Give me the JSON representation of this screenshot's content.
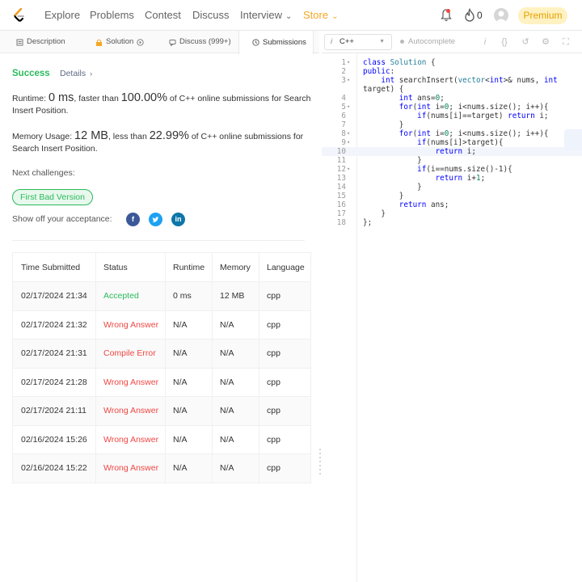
{
  "nav": {
    "items": [
      "Explore",
      "Problems",
      "Contest",
      "Discuss",
      "Interview",
      "Store"
    ],
    "fire_count": "0",
    "premium": "Premium"
  },
  "tabs": [
    "Description",
    "Solution",
    "Discuss (999+)",
    "Submissions"
  ],
  "result": {
    "status": "Success",
    "details": "Details",
    "runtime_label": "Runtime: ",
    "runtime_value": "0 ms",
    "runtime_mid": ", faster than ",
    "runtime_pct": "100.00%",
    "runtime_tail": " of C++ online submissions for Search Insert Position.",
    "memory_label": "Memory Usage: ",
    "memory_value": "12 MB",
    "memory_mid": ", less than ",
    "memory_pct": "22.99%",
    "memory_tail": " of C++ online submissions for Search Insert Position.",
    "next_label": "Next challenges:",
    "next_challenge": "First Bad Version",
    "share_label": "Show off your acceptance:"
  },
  "table": {
    "headers": [
      "Time Submitted",
      "Status",
      "Runtime",
      "Memory",
      "Language"
    ],
    "rows": [
      [
        "02/17/2024 21:34",
        "Accepted",
        "0 ms",
        "12 MB",
        "cpp"
      ],
      [
        "02/17/2024 21:32",
        "Wrong Answer",
        "N/A",
        "N/A",
        "cpp"
      ],
      [
        "02/17/2024 21:31",
        "Compile Error",
        "N/A",
        "N/A",
        "cpp"
      ],
      [
        "02/17/2024 21:28",
        "Wrong Answer",
        "N/A",
        "N/A",
        "cpp"
      ],
      [
        "02/17/2024 21:11",
        "Wrong Answer",
        "N/A",
        "N/A",
        "cpp"
      ],
      [
        "02/16/2024 15:26",
        "Wrong Answer",
        "N/A",
        "N/A",
        "cpp"
      ],
      [
        "02/16/2024 15:22",
        "Wrong Answer",
        "N/A",
        "N/A",
        "cpp"
      ]
    ]
  },
  "editor": {
    "language": "C++",
    "autocomplete": "Autocomplete",
    "code_lines": [
      "class Solution {",
      "public:",
      "    int searchInsert(vector<int>& nums, int",
      "target) {",
      "        int ans=0;",
      "        for(int i=0; i<nums.size(); i++){",
      "            if(nums[i]==target) return i;",
      "        }",
      "        for(int i=0; i<nums.size(); i++){",
      "            if(nums[i]>target){",
      "                return i;",
      "            }",
      "            if(i==nums.size()-1){",
      "                return i+1;",
      "            }",
      "        }",
      "        return ans;",
      "    }",
      "};"
    ],
    "line_numbers": [
      "1",
      "2",
      "3",
      "",
      "4",
      "5",
      "6",
      "7",
      "8",
      "9",
      "10",
      "11",
      "12",
      "13",
      "14",
      "15",
      "16",
      "17",
      "18"
    ]
  },
  "colors": {
    "accent_green": "#2cbb5d",
    "error_red": "#ef4743",
    "brand_orange": "#f5a623"
  }
}
